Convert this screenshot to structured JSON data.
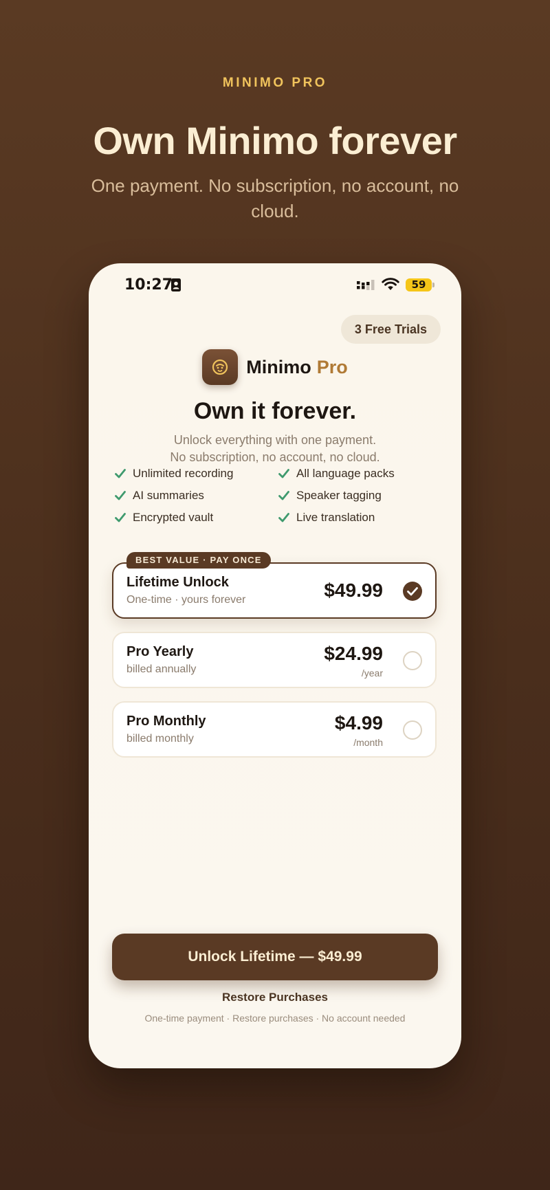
{
  "promo": {
    "eyebrow": "MINIMO PRO",
    "title": "Own Minimo forever",
    "subtitle": "One payment. No subscription, no account, no cloud."
  },
  "status_bar": {
    "time": "10:27",
    "battery": "59",
    "icons": [
      "contact-card-icon",
      "cellular-signal-icon",
      "wifi-icon",
      "battery-icon"
    ]
  },
  "paywall": {
    "trials_label": "3 Free Trials",
    "brand_name": "Minimo",
    "brand_suffix": "Pro",
    "headline": "Own it forever.",
    "subline_1": "Unlock everything with one payment.",
    "subline_2": "No subscription, no account, no cloud.",
    "features": [
      "Unlimited recording",
      "All language packs",
      "AI summaries",
      "Speaker tagging",
      "Encrypted vault",
      "Live translation"
    ],
    "badge": "BEST VALUE · PAY ONCE",
    "plans": [
      {
        "name": "Lifetime Unlock",
        "desc": "One-time · yours forever",
        "price": "$49.99",
        "period": "",
        "selected": true
      },
      {
        "name": "Pro Yearly",
        "desc": "billed annually",
        "price": "$24.99",
        "period": "/year",
        "selected": false
      },
      {
        "name": "Pro Monthly",
        "desc": "billed monthly",
        "price": "$4.99",
        "period": "/month",
        "selected": false
      }
    ],
    "cta_label": "Unlock Lifetime — $49.99",
    "restore_label": "Restore Purchases",
    "footer_note": "One-time payment · Restore purchases · No account needed"
  },
  "colors": {
    "background": "#4e311f",
    "accent_gold": "#f0c35c",
    "brand_brown": "#5a3a24",
    "check_green": "#3f9a6e"
  }
}
